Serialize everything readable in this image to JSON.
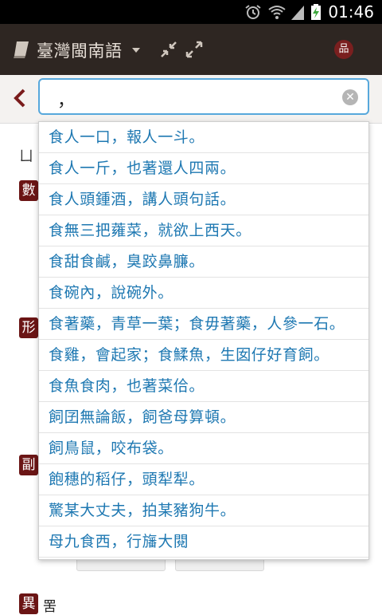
{
  "status_bar": {
    "time": "01:46"
  },
  "action_bar": {
    "title": "臺灣閩南語",
    "seal_char": "品"
  },
  "search": {
    "value": "，"
  },
  "background": {
    "line_char": "ㄩ",
    "badges": [
      "數",
      "形",
      "副",
      "異"
    ],
    "last_text": "罟"
  },
  "suggestions": [
    "食人一口，報人一斗。",
    "食人一斤，也著還人四兩。",
    "食人頭鍾酒，講人頭句話。",
    "食無三把蕹菜，就欲上西天。",
    "食甜食鹹，臭跤鼻臁。",
    "食碗內，說碗外。",
    "食著藥，青草一葉；食毋著藥，人參一石。",
    "食雞，會起家；食鰇魚，生囡仔好育飼。",
    "食魚食肉，也著菜佮。",
    "飼囝無論飯，飼爸母算頓。",
    "飼鳥鼠，咬布袋。",
    "飽穗的稻仔，頭犁犁。",
    "驚某大丈夫，拍某豬狗牛。",
    "母九食西，行旛大閱"
  ]
}
